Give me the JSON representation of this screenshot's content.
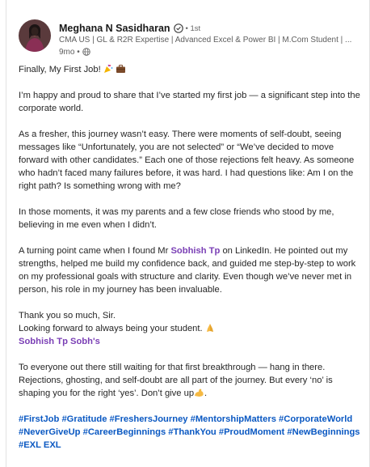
{
  "author": {
    "name": "Meghana N Sasidharan",
    "degree": "• 1st",
    "headline": "CMA US | GL & R2R Expertise | Advanced Excel & Power BI | M.Com Student | ...",
    "time": "9mo •"
  },
  "post": {
    "line1": "Finally, My First Job! ",
    "p2": "I’m happy and proud to share that I’ve started my first job — a significant step into the corporate world.",
    "p3": "As a fresher, this journey wasn’t easy. There were moments of self-doubt, seeing messages like “Unfortunately, you are not selected” or “We’ve decided to move forward with other candidates.” Each one of those rejections felt heavy. As someone who hadn’t faced many failures before, it was hard. I had questions like: Am I on the right path? Is something wrong with me?",
    "p4": "In those moments, it was my parents and a few close friends who stood by me, believing in me even when I didn’t.",
    "p5_before": "A turning point came when I found Mr ",
    "p5_mention": "Sobhish Tp",
    "p5_after": " on LinkedIn. He pointed out my strengths, helped me build my confidence back, and guided me step-by-step to work on my professional goals with structure and clarity. Even though we’ve never met in person, his role in my journey has been invaluable.",
    "p6": "Thank you so much, Sir.",
    "p7": "Looking forward to always being your student. ",
    "mention_line": "Sobhish Tp Sobh's",
    "p8": "To everyone out there still waiting for that first breakthrough — hang in there. Rejections, ghosting, and self-doubt are all part of the journey. But every ‘no’ is shaping you for the right ‘yes’. Don’t give up",
    "p8_end": ".",
    "hashtags_line1": "#FirstJob #Gratitude #FreshersJourney #MentorshipMatters #CorporateWorld",
    "hashtags_line2": "#NeverGiveUp #CareerBeginnings #ThankYou #ProudMoment #NewBeginnings",
    "hashtags_line3": "#EXL EXL"
  },
  "icons": {
    "verified": "verified-badge-icon",
    "visibility": "globe-icon"
  },
  "colors": {
    "mention": "#7a3fb5",
    "hashtag": "#0a58c2"
  }
}
